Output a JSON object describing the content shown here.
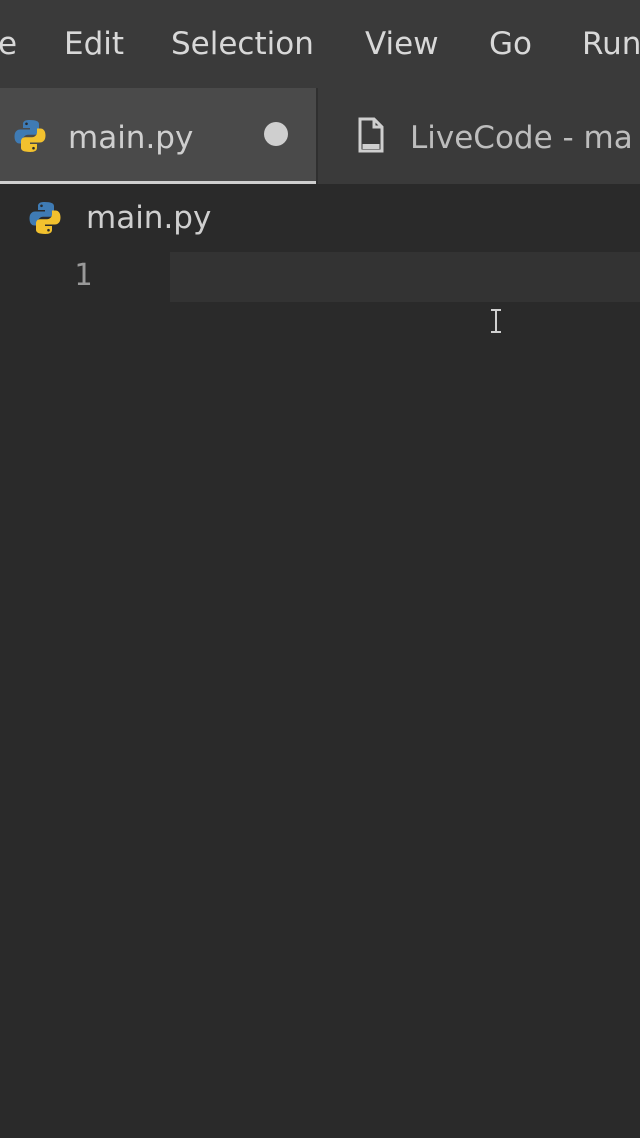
{
  "menubar": {
    "items": [
      {
        "label": "e"
      },
      {
        "label": "Edit"
      },
      {
        "label": "Selection"
      },
      {
        "label": "View"
      },
      {
        "label": "Go"
      },
      {
        "label": "Run"
      }
    ]
  },
  "tabs": [
    {
      "label": "main.py",
      "icon": "python-icon",
      "dirty": true,
      "active": true
    },
    {
      "label": "LiveCode - ma",
      "icon": "document-icon",
      "active": false
    }
  ],
  "breadcrumb": {
    "label": "main.py",
    "icon": "python-icon"
  },
  "editor": {
    "line_numbers": [
      "1"
    ],
    "cursor": "text-cursor-icon"
  },
  "colors": {
    "python_blue": "#3f7bb4",
    "python_yellow": "#f2c12e",
    "background": "#2a2a2a",
    "tab_active": "#4a4a4a"
  }
}
